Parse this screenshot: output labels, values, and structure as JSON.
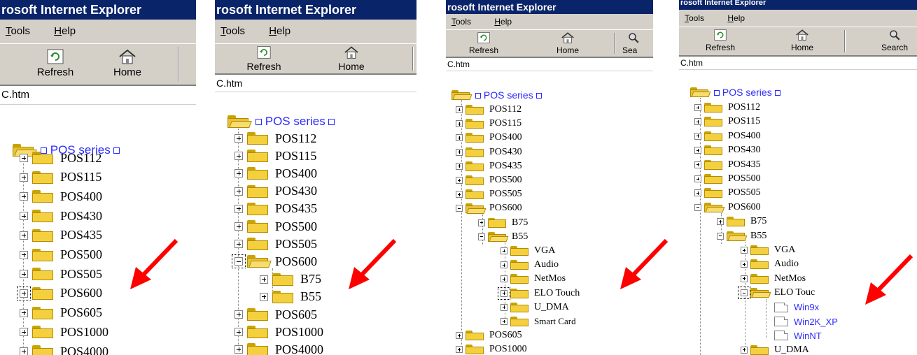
{
  "browser": {
    "title": "rosoft Internet Explorer",
    "menu": {
      "tools": "Tools",
      "tools_key": "T",
      "tools_rest": "ools",
      "help": "Help",
      "help_key": "H",
      "help_rest": "elp"
    },
    "toolbar": {
      "refresh": "Refresh",
      "home": "Home",
      "search": "Sea",
      "search_full": "Search"
    },
    "address": "C.htm"
  },
  "tree": {
    "root": "POS series",
    "panel1": [
      "POS112",
      "POS115",
      "POS400",
      "POS430",
      "POS435",
      "POS500",
      "POS505",
      "POS600",
      "POS605",
      "POS1000",
      "POS4000"
    ],
    "panel2": {
      "top": [
        "POS112",
        "POS115",
        "POS400",
        "POS430",
        "POS435",
        "POS500",
        "POS505"
      ],
      "expanded": "POS600",
      "children": [
        "B75",
        "B55"
      ],
      "bottom": [
        "POS605",
        "POS1000",
        "POS4000"
      ]
    },
    "panel3": {
      "top": [
        "POS112",
        "POS115",
        "POS400",
        "POS430",
        "POS435",
        "POS500",
        "POS505"
      ],
      "expanded": "POS600",
      "b75": "B75",
      "b55": "B55",
      "b55_children": [
        "VGA",
        "Audio",
        "NetMos",
        "ELO Touch",
        "U_DMA",
        "Smart Card"
      ],
      "bottom": [
        "POS605",
        "POS1000"
      ]
    },
    "panel4": {
      "top": [
        "POS112",
        "POS115",
        "POS400",
        "POS430",
        "POS435",
        "POS500",
        "POS505"
      ],
      "expanded": "POS600",
      "b75": "B75",
      "b55": "B55",
      "b55_children": [
        "VGA",
        "Audio",
        "NetMos"
      ],
      "elo": "ELO Touc",
      "elo_children": [
        "Win9x",
        "Win2K_XP",
        "WinNT"
      ],
      "after": "U_DMA"
    }
  },
  "colors": {
    "title_bar": "#0a246a",
    "chrome": "#d4d0c8",
    "link": "#2b2bff",
    "folder": "#f4d03f",
    "arrow": "#ff0000"
  }
}
